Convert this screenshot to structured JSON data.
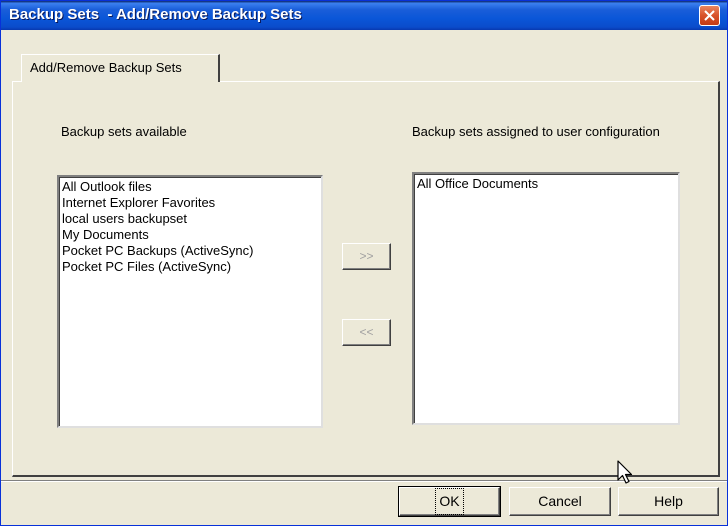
{
  "window": {
    "title": "Backup Sets  - Add/Remove Backup Sets",
    "close_icon": "close-icon"
  },
  "tabs": [
    {
      "label": "Add/Remove Backup Sets",
      "active": true
    }
  ],
  "available": {
    "label": "Backup sets available",
    "items": [
      "All Outlook files",
      "Internet Explorer Favorites",
      "local users backupset",
      "My Documents",
      "Pocket PC Backups (ActiveSync)",
      "Pocket PC Files (ActiveSync)"
    ]
  },
  "assigned": {
    "label": "Backup sets assigned to user configuration",
    "items": [
      "All Office Documents"
    ]
  },
  "transfer": {
    "add_label": ">>",
    "remove_label": "<<"
  },
  "footer": {
    "ok_label": "OK",
    "cancel_label": "Cancel",
    "help_label": "Help"
  },
  "colors": {
    "titlebar": "#0a56d8",
    "dialog_bg": "#ece9d8",
    "close_button": "#d8522a"
  }
}
